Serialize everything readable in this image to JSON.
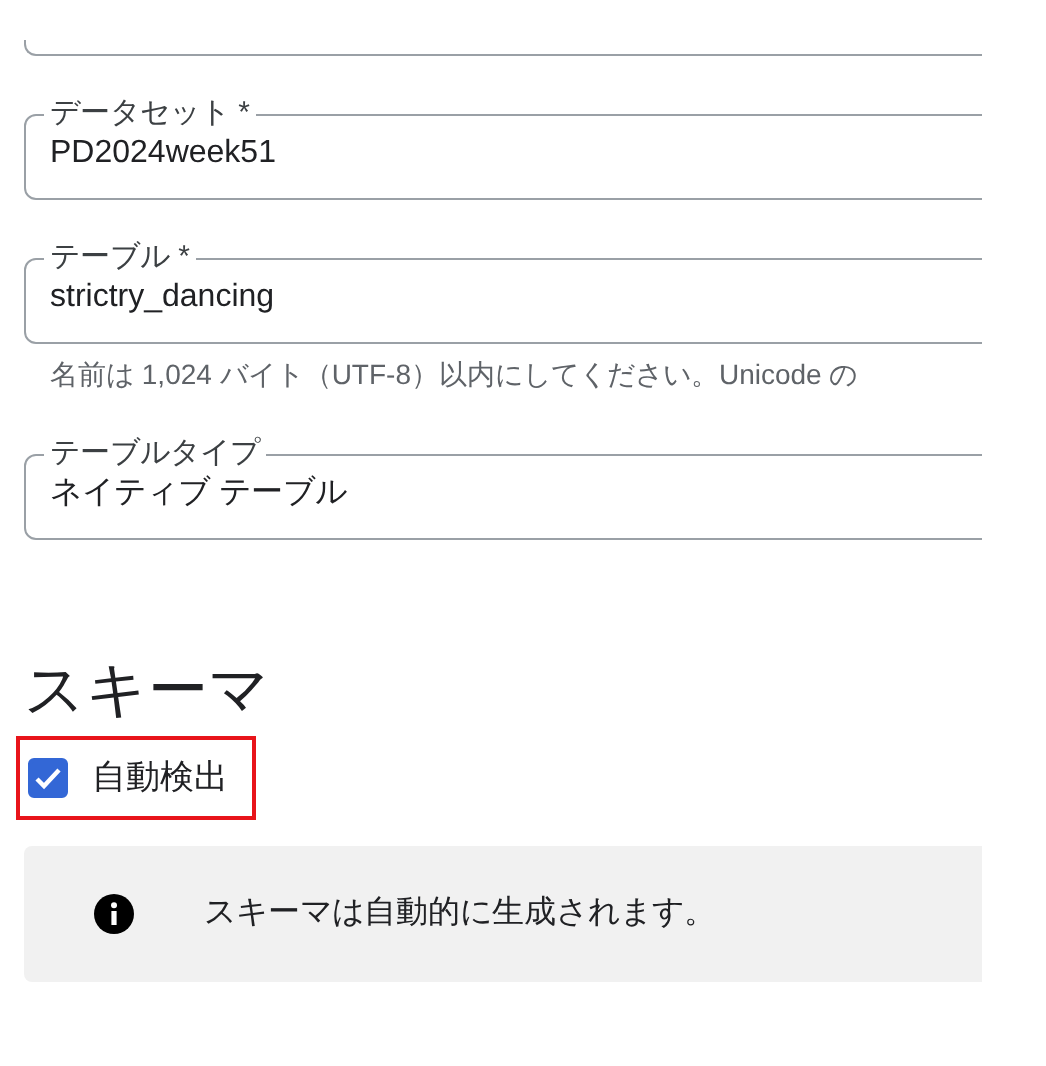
{
  "fields": [
    {
      "kind": "partial"
    },
    {
      "kind": "text",
      "label": "データセット *",
      "value": "PD2024week51"
    },
    {
      "kind": "text",
      "label": "テーブル *",
      "value": "strictry_dancing",
      "hint": "名前は 1,024 バイト（UTF-8）以内にしてください。Unicode の"
    },
    {
      "kind": "text",
      "label": "テーブルタイプ",
      "value": "ネイティブ テーブル"
    }
  ],
  "schema": {
    "heading": "スキーマ",
    "auto_detect": {
      "label": "自動検出",
      "checked": true,
      "highlighted": true
    },
    "info": "スキーマは自動的に生成されます。"
  }
}
